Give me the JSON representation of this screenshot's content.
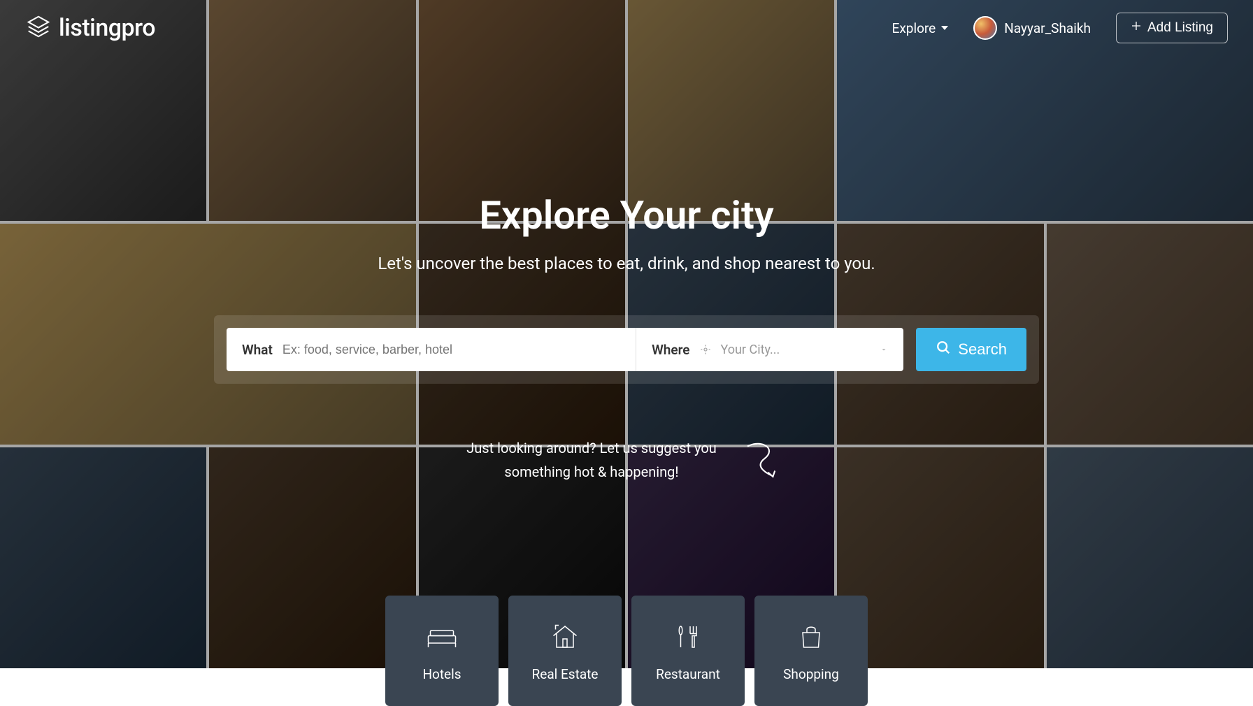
{
  "brand": {
    "name": "listingpro"
  },
  "nav": {
    "explore_label": "Explore",
    "user_name": "Nayyar_Shaikh",
    "add_listing_label": "Add Listing"
  },
  "hero": {
    "title": "Explore Your city",
    "subtitle": "Let's uncover the best places to eat, drink, and shop nearest to you.",
    "suggest_line1": "Just looking around? Let us suggest you",
    "suggest_line2": "something hot & happening!"
  },
  "search": {
    "what_label": "What",
    "what_placeholder": "Ex: food, service, barber, hotel",
    "where_label": "Where",
    "where_placeholder": "Your City...",
    "button_label": "Search"
  },
  "categories": [
    {
      "label": "Hotels",
      "icon": "bed-icon"
    },
    {
      "label": "Real Estate",
      "icon": "house-icon"
    },
    {
      "label": "Restaurant",
      "icon": "utensils-icon"
    },
    {
      "label": "Shopping",
      "icon": "bag-icon"
    }
  ],
  "colors": {
    "accent": "#3db6e8",
    "tile": "#3a4552"
  }
}
